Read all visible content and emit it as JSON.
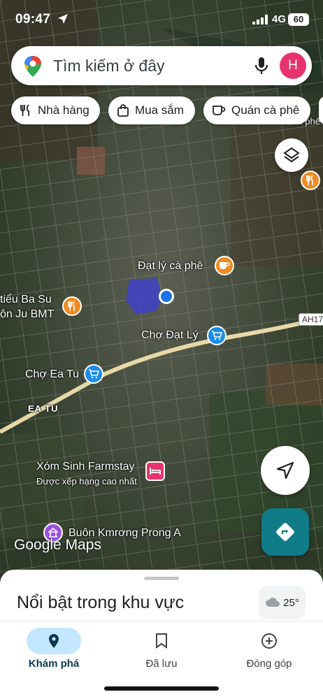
{
  "status_bar": {
    "time": "09:47",
    "network": "4G",
    "battery": "60"
  },
  "search": {
    "placeholder": "Tìm kiếm ở đây",
    "avatar_letter": "H"
  },
  "chips": [
    {
      "label": "Nhà hàng",
      "icon": "fork-knife-icon"
    },
    {
      "label": "Mua sắm",
      "icon": "shopping-bag-icon"
    },
    {
      "label": "Quán cà phê",
      "icon": "coffee-cup-icon"
    }
  ],
  "map": {
    "labels": {
      "dat_ly_cafe": "Đạt lý cà phê",
      "ba_su_line1": "tiểu Ba Su",
      "ba_su_line2": "ôn Ju BMT",
      "cho_dat_ly": "Chợ Đạt Lý",
      "cho_ea_tu": "Chợ Ea Tu",
      "ea_tu": "EA TU",
      "xom_sinh": "Xóm Sinh Farmstay",
      "xom_sinh_sub": "Được xếp hạng cao nhất",
      "buon_kmrong": "Buôn Kmrơng Prong A",
      "cafe_top_right": "Cà phê",
      "road_shield": "AH17",
      "google_logo": "Google Maps"
    }
  },
  "sheet": {
    "title": "Nổi bật trong khu vực",
    "weather": "25°"
  },
  "nav": [
    {
      "label": "Khám phá",
      "icon": "explore-pin-icon",
      "active": true
    },
    {
      "label": "Đã lưu",
      "icon": "bookmark-icon",
      "active": false
    },
    {
      "label": "Đóng góp",
      "icon": "add-circle-icon",
      "active": false
    }
  ],
  "colors": {
    "accent": "#0f7c87",
    "avatar": "#e8336e",
    "nav_active": "#c2e7ff",
    "my_location": "#1a73e8"
  }
}
